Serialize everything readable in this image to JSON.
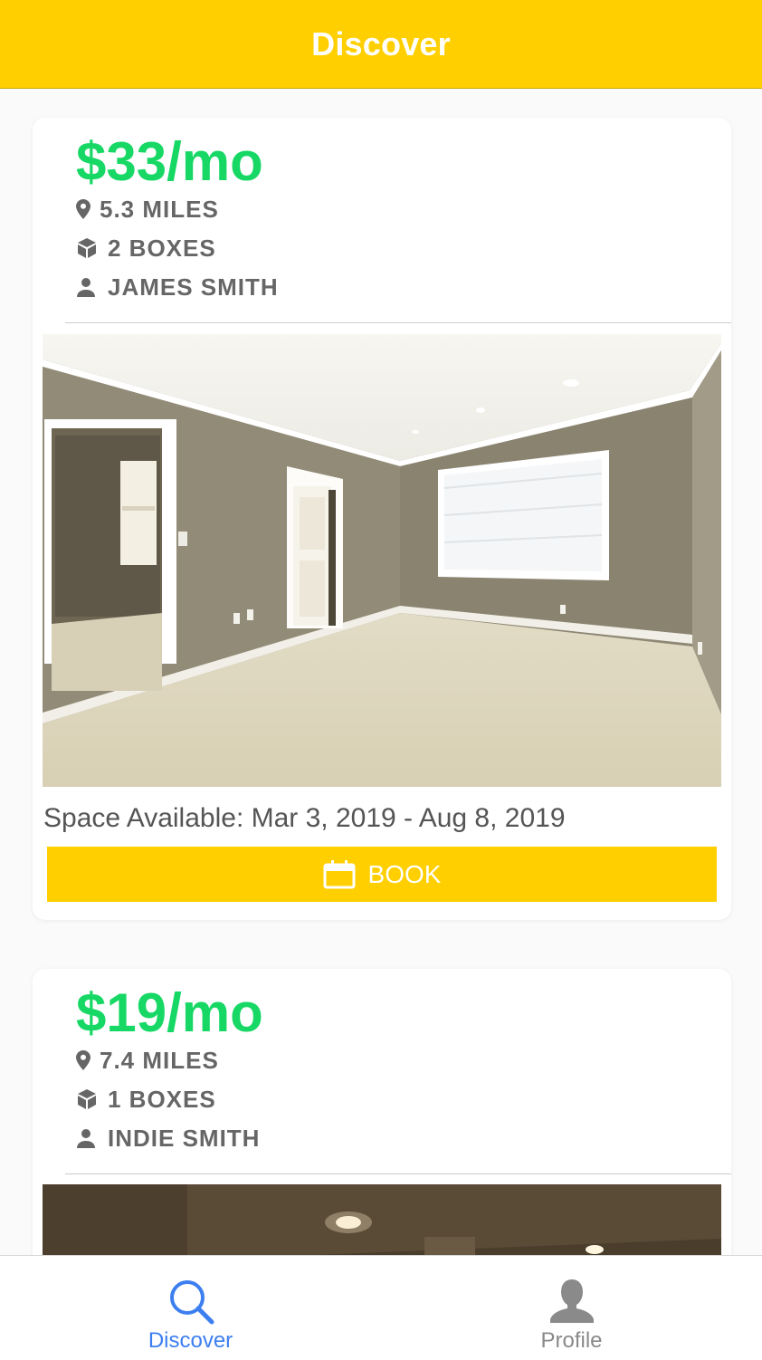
{
  "header": {
    "title": "Discover"
  },
  "listings": [
    {
      "price": "$33/mo",
      "distance": "5.3 MILES",
      "boxes": "2 BOXES",
      "owner": "JAMES SMITH",
      "availability": "Space Available: Mar 3, 2019 - Aug 8, 2019",
      "book_label": "BOOK"
    },
    {
      "price": "$19/mo",
      "distance": "7.4 MILES",
      "boxes": "1 BOXES",
      "owner": "INDIE SMITH"
    }
  ],
  "tabs": [
    {
      "label": "Discover",
      "icon": "search-icon",
      "active": true
    },
    {
      "label": "Profile",
      "icon": "person-icon",
      "active": false
    }
  ],
  "colors": {
    "accent": "#ffcf00",
    "price": "#17d865",
    "tab_active": "#3d7ff0",
    "tab_inactive": "#8a8a8a"
  }
}
